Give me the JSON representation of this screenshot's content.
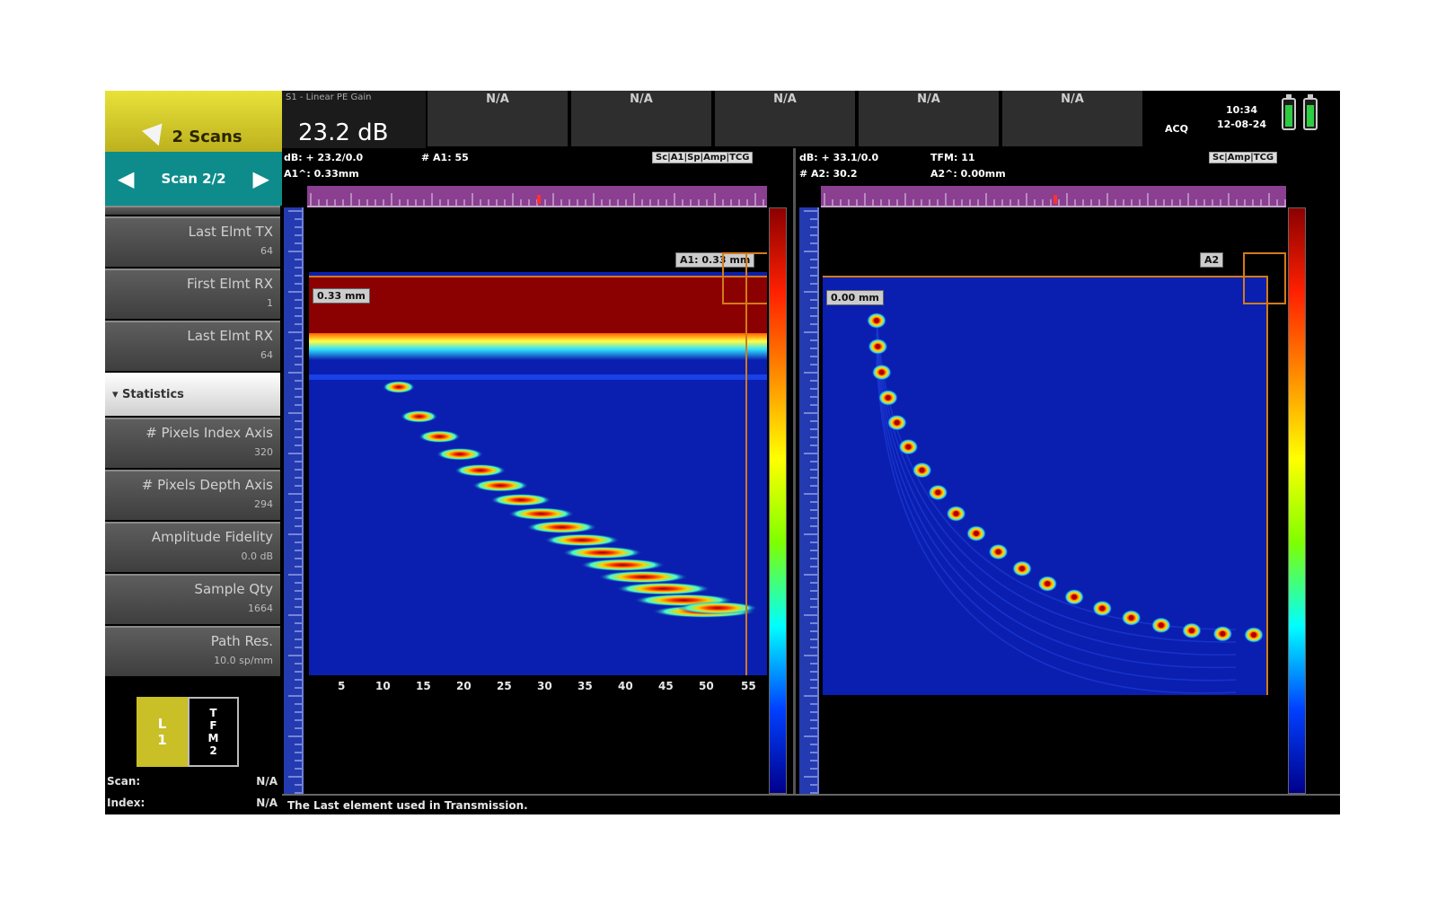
{
  "left_panel": {
    "scans_button": "2 Scans",
    "scan_nav": {
      "label": "Scan 2/2"
    },
    "params": [
      {
        "label": "Last Elmt TX",
        "value": "64"
      },
      {
        "label": "First Elmt RX",
        "value": "1"
      },
      {
        "label": "Last Elmt RX",
        "value": "64"
      }
    ],
    "section_header": "▾ Statistics",
    "stats": [
      {
        "label": "# Pixels Index Axis",
        "value": "320"
      },
      {
        "label": "# Pixels Depth Axis",
        "value": "294"
      },
      {
        "label": "Amplitude Fidelity",
        "value": "0.0 dB"
      },
      {
        "label": "Sample Qty",
        "value": "1664"
      },
      {
        "label": "Path Res.",
        "value": "10.0 sp/mm"
      }
    ],
    "groups": [
      {
        "lines": [
          "L",
          "1"
        ]
      },
      {
        "lines": [
          "T",
          "F",
          "M",
          "2"
        ]
      }
    ],
    "readouts": [
      {
        "label": "Scan:",
        "value": "N/A"
      },
      {
        "label": "Index:",
        "value": "N/A"
      }
    ]
  },
  "top_bar": {
    "gain_label": "S1 - Linear PE Gain",
    "gain_value": "23.2 dB",
    "fields": [
      "N/A",
      "N/A",
      "N/A",
      "N/A",
      "N/A"
    ],
    "acq": "ACQ",
    "time": "10:34",
    "date": "12-08-24"
  },
  "view_left": {
    "header_line1": "dB: + 23.2/0.0",
    "header_line2": "# A1: 55",
    "header_line3": "A1^: 0.33mm",
    "tags": "Sc|A1|Sp|Amp|TCG",
    "gate_tag": "A1: 0.33 mm",
    "depth_chip": "0.33 mm",
    "x_ticks": [
      "5",
      "10",
      "15",
      "20",
      "25",
      "30",
      "35",
      "40",
      "45",
      "50",
      "55"
    ]
  },
  "view_right": {
    "header_line1": "dB: + 33.1/0.0",
    "header_line2": "TFM: 11",
    "header_line3": "# A2: 30.2",
    "header_line4": "A2^: 0.00mm",
    "tags": "Sc|Amp|TCG",
    "gate_tag": "A2",
    "depth_chip": "0.00 mm"
  },
  "status_bar": "The Last element used in Transmission.",
  "colors": {
    "accent_yellow": "#c9bf27",
    "accent_teal": "#0e8c8c",
    "scan_background": "#0a1fb0",
    "ruler_purple": "#8a3f91",
    "ruler_blue": "#243ab0",
    "cursor_orange": "#d47a1a"
  }
}
